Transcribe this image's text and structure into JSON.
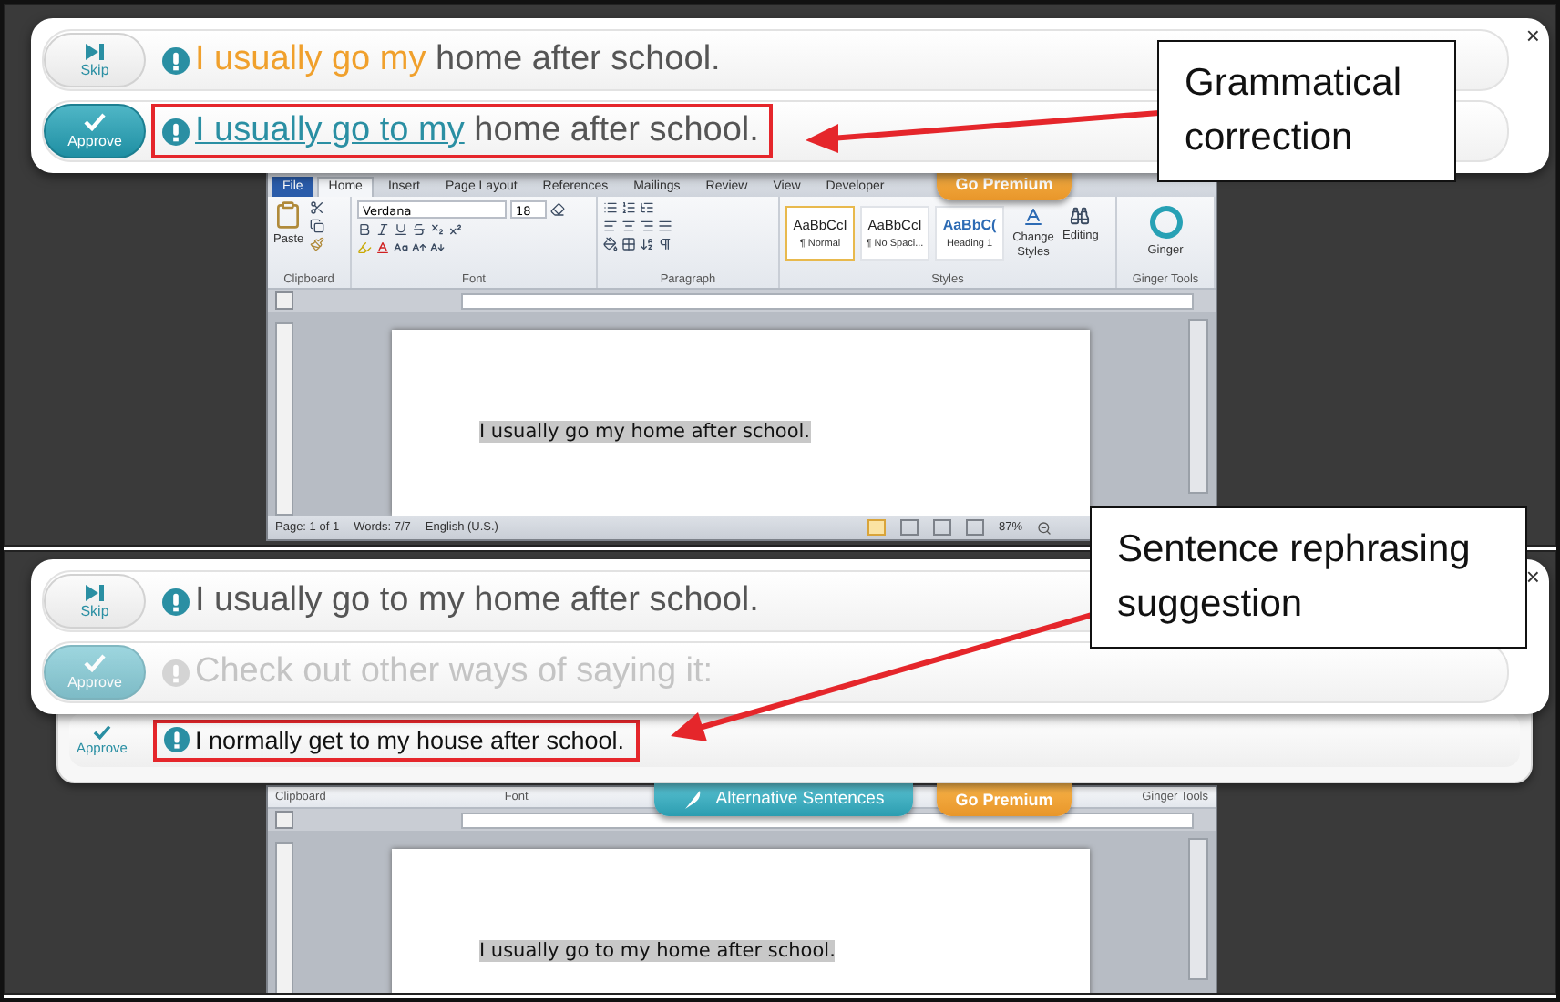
{
  "panels": [
    {
      "word": {
        "tabs": [
          {
            "label": "File",
            "selected": false,
            "kind": "file"
          },
          {
            "label": "Home",
            "selected": true,
            "kind": "tab"
          },
          {
            "label": "Insert",
            "selected": false,
            "kind": "tab"
          },
          {
            "label": "Page Layout",
            "selected": false,
            "kind": "tab"
          },
          {
            "label": "References",
            "selected": false,
            "kind": "tab"
          },
          {
            "label": "Mailings",
            "selected": false,
            "kind": "tab"
          },
          {
            "label": "Review",
            "selected": false,
            "kind": "tab"
          },
          {
            "label": "View",
            "selected": false,
            "kind": "tab"
          },
          {
            "label": "Developer",
            "selected": false,
            "kind": "tab"
          }
        ],
        "paste": "Paste",
        "font_name": "Verdana",
        "font_size": "18",
        "styles": [
          {
            "sample": "AaBbCcI",
            "name": "¶ Normal",
            "selected": true,
            "kind": "body"
          },
          {
            "sample": "AaBbCcI",
            "name": "¶ No Spaci...",
            "selected": false,
            "kind": "body"
          },
          {
            "sample": "AaBbC(",
            "name": "Heading 1",
            "selected": false,
            "kind": "heading"
          }
        ],
        "change_styles": "Change Styles",
        "editing": "Editing",
        "ginger": "Ginger",
        "group_labels": [
          "Clipboard",
          "Font",
          "Paragraph",
          "Styles",
          "Ginger Tools"
        ],
        "overlays": [
          {
            "kind": "premium",
            "label": "Go Premium"
          }
        ],
        "document_text": "I usually go my home after school.",
        "status": [
          "Page: 1 of 1",
          "Words: 7/7",
          "English (U.S.)"
        ],
        "zoom": "87%"
      },
      "ginger": {
        "close": "×",
        "rows": [
          {
            "kind": "skip",
            "button": "Skip",
            "disabled": false,
            "highlighted": false,
            "segments": [
              {
                "kind": "error",
                "text": "I usually go my"
              },
              {
                "kind": "plain",
                "text": " home after school."
              }
            ]
          },
          {
            "kind": "approve",
            "button": "Approve",
            "disabled": false,
            "highlighted": true,
            "segments": [
              {
                "kind": "fix",
                "text": "I usually go to my"
              },
              {
                "kind": "plain",
                "text": " home after school."
              }
            ]
          }
        ]
      },
      "callout": "Grammatical correction"
    },
    {
      "word": {
        "group_labels": [
          "Clipboard",
          "Font",
          "Ginger Tools"
        ],
        "overlays": [
          {
            "kind": "alternatives",
            "label": "Alternative Sentences"
          },
          {
            "kind": "premium",
            "label": "Go Premium"
          }
        ],
        "document_text": "I usually go to my home after school."
      },
      "ginger": {
        "close": "×",
        "rows": [
          {
            "kind": "skip",
            "button": "Skip",
            "disabled": false,
            "highlighted": false,
            "segments": [
              {
                "kind": "plain",
                "text": "I usually go to my home after school."
              }
            ]
          },
          {
            "kind": "approve",
            "button": "Approve",
            "disabled": true,
            "highlighted": false,
            "segments": [
              {
                "kind": "plain",
                "text": "Check out other ways of saying it:"
              }
            ]
          }
        ],
        "suggestions": [
          {
            "button": "Approve",
            "text": "I normally get to my house after school.",
            "highlighted": true
          }
        ]
      },
      "callout": "Sentence rephrasing suggestion"
    }
  ]
}
